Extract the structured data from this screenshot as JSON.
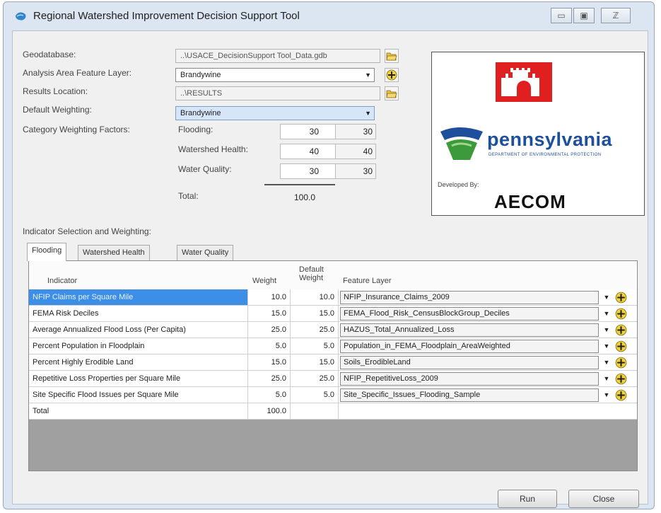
{
  "window": {
    "title": "Regional Watershed Improvement Decision Support Tool",
    "minimize": "▭",
    "maximize": "▣",
    "close": "ℤ"
  },
  "form": {
    "geodatabase_label": "Geodatabase:",
    "geodatabase_value": "..\\USACE_DecisionSupport Tool_Data.gdb",
    "analysis_label": "Analysis Area Feature Layer:",
    "analysis_value": "Brandywine",
    "results_label": "Results Location:",
    "results_value": "..\\RESULTS",
    "default_weighting_label": "Default Weighting:",
    "default_weighting_value": "Brandywine",
    "category_label": "Category Weighting Factors:",
    "categories": [
      {
        "label": "Flooding:",
        "value": "30",
        "default": "30"
      },
      {
        "label": "Watershed Health:",
        "value": "40",
        "default": "40"
      },
      {
        "label": "Water Quality:",
        "value": "30",
        "default": "30"
      }
    ],
    "total_label": "Total:",
    "total_value": "100.0"
  },
  "logos": {
    "state_name": "pennsylvania",
    "dept_name": "DEPARTMENT OF ENVIRONMENTAL PROTECTION",
    "developed_by": "Developed By:",
    "developer": "AECOM"
  },
  "indicator_section_label": "Indicator Selection and Weighting:",
  "tabs": [
    {
      "label": "Flooding",
      "active": true
    },
    {
      "label": "Watershed Health",
      "active": false
    },
    {
      "label": "Water Quality",
      "active": false
    }
  ],
  "grid": {
    "headers": {
      "indicator": "Indicator",
      "weight": "Weight",
      "default_weight_1": "Default",
      "default_weight_2": "Weight",
      "feature_layer": "Feature Layer"
    },
    "rows": [
      {
        "indicator": "NFIP Claims per Square Mile",
        "weight": "10.0",
        "default": "10.0",
        "layer": "NFIP_Insurance_Claims_2009"
      },
      {
        "indicator": "FEMA Risk Deciles",
        "weight": "15.0",
        "default": "15.0",
        "layer": "FEMA_Flood_Risk_CensusBlockGroup_Deciles"
      },
      {
        "indicator": "Average Annualized Flood Loss (Per Capita)",
        "weight": "25.0",
        "default": "25.0",
        "layer": "HAZUS_Total_Annualized_Loss"
      },
      {
        "indicator": "Percent Population in Floodplain",
        "weight": "5.0",
        "default": "5.0",
        "layer": "Population_in_FEMA_Floodplain_AreaWeighted"
      },
      {
        "indicator": "Percent Highly Erodible Land",
        "weight": "15.0",
        "default": "15.0",
        "layer": "Soils_ErodibleLand"
      },
      {
        "indicator": "Repetitive Loss Properties per Square Mile",
        "weight": "25.0",
        "default": "25.0",
        "layer": "NFIP_RepetitiveLoss_2009"
      },
      {
        "indicator": "Site Specific Flood Issues per Square Mile",
        "weight": "5.0",
        "default": "5.0",
        "layer": "Site_Specific_Issues_Flooding_Sample"
      }
    ],
    "total_label": "Total",
    "total_weight": "100.0"
  },
  "buttons": {
    "run": "Run",
    "close": "Close"
  },
  "colors": {
    "selection": "#3d8ee6",
    "pa_blue": "#1d4f9c",
    "pa_green": "#3c9a3a",
    "usace_red": "#e02020"
  }
}
